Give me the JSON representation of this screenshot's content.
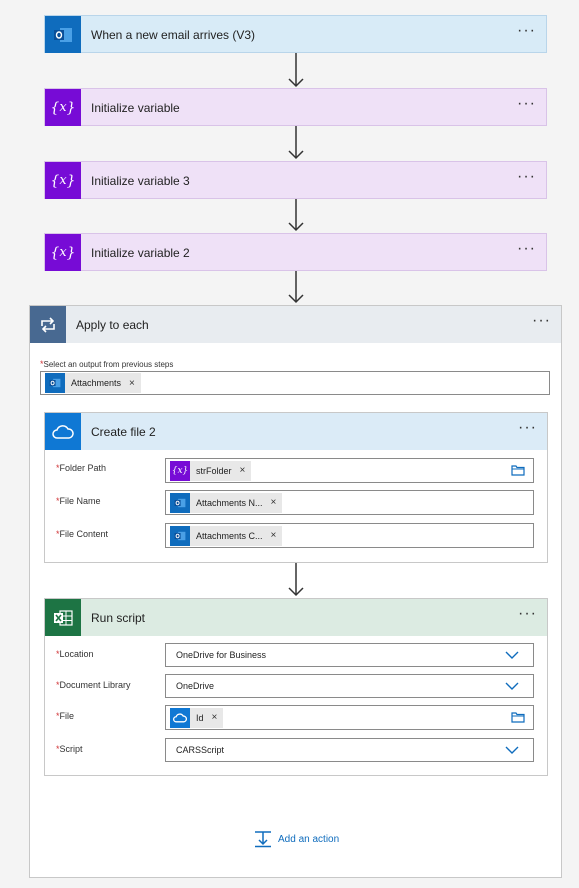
{
  "steps": {
    "email_trigger": {
      "title": "When a new email arrives (V3)",
      "icon": "outlook-icon"
    },
    "init_var_1": {
      "title": "Initialize variable",
      "icon": "variable-icon"
    },
    "init_var_3": {
      "title": "Initialize variable 3",
      "icon": "variable-icon"
    },
    "init_var_2": {
      "title": "Initialize variable 2",
      "icon": "variable-icon"
    }
  },
  "apply_to_each": {
    "title": "Apply to each",
    "select_label": "Select an output from previous steps",
    "select_token": "Attachments",
    "add_action_label": "Add an action"
  },
  "create_file": {
    "title": "Create file 2",
    "fields": {
      "folder_path": {
        "label": "Folder Path",
        "token": "strFolder"
      },
      "file_name": {
        "label": "File Name",
        "token": "Attachments N..."
      },
      "file_content": {
        "label": "File Content",
        "token": "Attachments C..."
      }
    }
  },
  "run_script": {
    "title": "Run script",
    "fields": {
      "location": {
        "label": "Location",
        "value": "OneDrive for Business"
      },
      "document_library": {
        "label": "Document Library",
        "value": "OneDrive"
      },
      "file": {
        "label": "File",
        "token": "Id"
      },
      "script": {
        "label": "Script",
        "value": "CARSScript"
      }
    }
  },
  "common": {
    "more": "···",
    "required_mark": "*",
    "remove": "×"
  },
  "colors": {
    "outlook": "#0f6cbd",
    "variable": "#770bd6",
    "variable_bg": "#efe1f7",
    "email_bg": "#d8ebf7",
    "loop": "#486991",
    "loop_bg": "#e8ecf0",
    "onedrive": "#0f78d4",
    "onedrive_bg": "#dbebf7",
    "excel": "#1d7444",
    "excel_bg": "#dcebe2",
    "link": "#0f6cbd"
  }
}
